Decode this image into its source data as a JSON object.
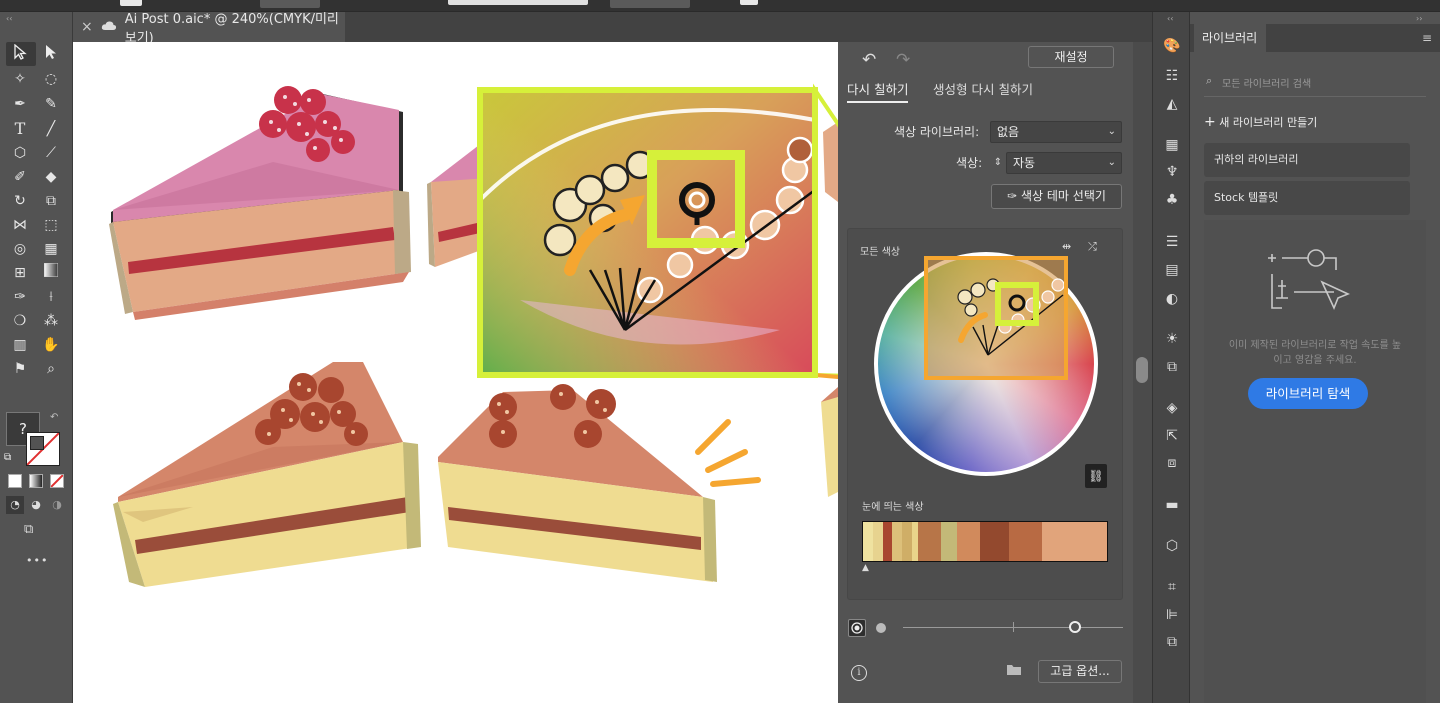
{
  "document": {
    "tab_title": "Ai Post 0.aic* @ 240%(CMYK/미리 보기)",
    "close_glyph": "×",
    "cloud_icon": "cloud-icon"
  },
  "recolor": {
    "reset_label": "재설정",
    "tabs": [
      "다시 칠하기",
      "생성형 다시 칠하기"
    ],
    "color_library_label": "색상 라이브러리:",
    "color_library_value": "없음",
    "colors_label": "색상:",
    "colors_value": "자동",
    "theme_picker_label": "색상 테마 선택기",
    "all_colors_label": "모든 색상",
    "prominent_colors_label": "눈에 띄는 색상",
    "advanced_options_label": "고급 옵션...",
    "prominent_colors": [
      {
        "color": "#efe2a0",
        "weight": 3
      },
      {
        "color": "#e7d38f",
        "weight": 3
      },
      {
        "color": "#a8462f",
        "weight": 3
      },
      {
        "color": "#dcc07a",
        "weight": 3
      },
      {
        "color": "#cfae67",
        "weight": 3
      },
      {
        "color": "#e9d48a",
        "weight": 2
      },
      {
        "color": "#b77548",
        "weight": 7
      },
      {
        "color": "#c3b978",
        "weight": 5
      },
      {
        "color": "#d18a5c",
        "weight": 7
      },
      {
        "color": "#93492e",
        "weight": 9
      },
      {
        "color": "#b86a43",
        "weight": 10
      },
      {
        "color": "#e1a47b",
        "weight": 20
      }
    ]
  },
  "library": {
    "title": "라이브러리",
    "search_placeholder": "모든 라이브러리 검색",
    "new_library_label": "새 라이브러리 만들기",
    "items": [
      "귀하의 라이브러리",
      "Stock 템플릿"
    ],
    "empty_message_line1": "이미 제작된 라이브러리로 작업 속도를 높",
    "empty_message_line2": "이고 영감을 주세요.",
    "explore_button": "라이브러리 탐색",
    "accent": "#2f7ae5"
  },
  "toolbar": {
    "help_glyph": "?",
    "more_glyph": "•••"
  },
  "colors": {
    "highlight": "#d6f03a",
    "orange": "#f5a630",
    "pink_frost": "#d987ad",
    "berry": "#c8324a"
  }
}
